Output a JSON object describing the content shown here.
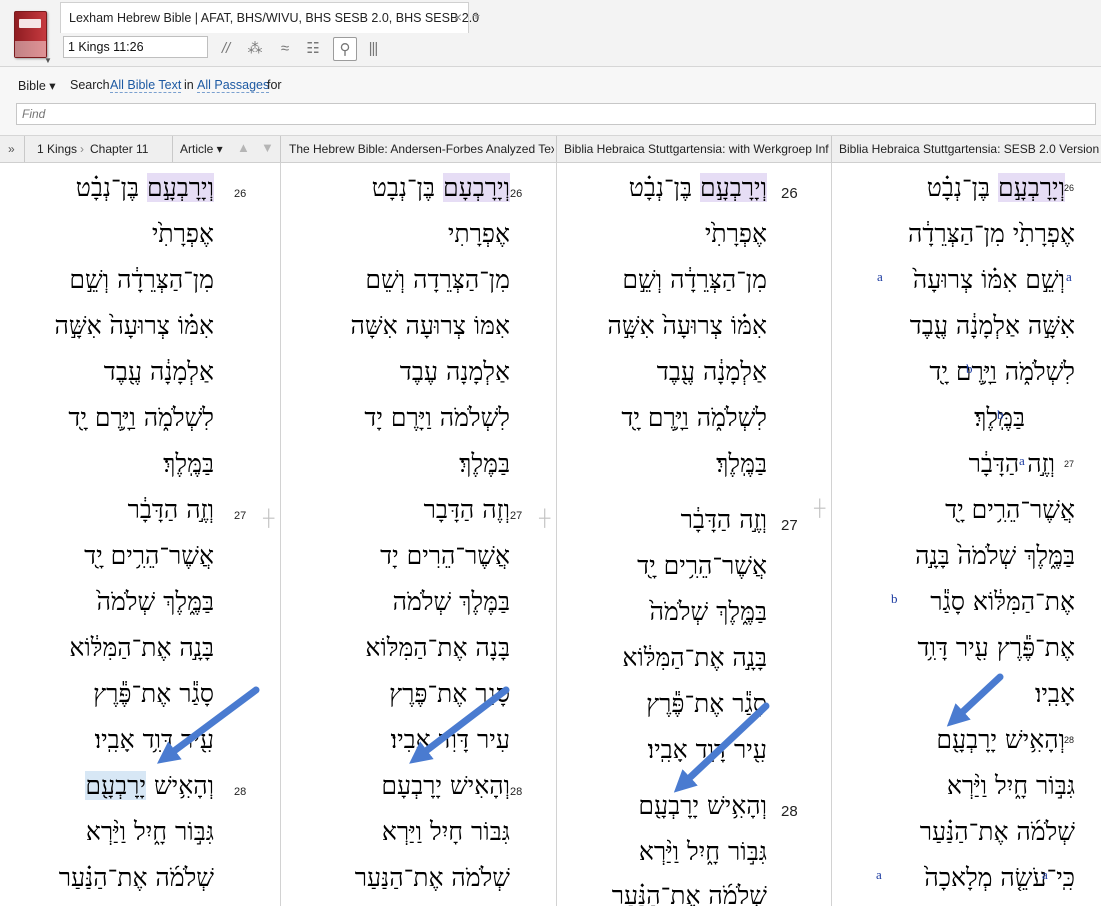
{
  "tab": {
    "title": "Lexham Hebrew Bible | AFAT, BHS/WIVU, BHS SESB 2.0, BHS SESB 2.0",
    "close": "×",
    "new_tab": "+"
  },
  "toolbar": {
    "reference": "1 Kings 11:26",
    "btn_parallel": "//",
    "btn_dots": "⁂",
    "btn_wave": "≈",
    "btn_list": "☷",
    "btn_search": "⚲",
    "btn_columns": "|||"
  },
  "search": {
    "bible_label": "Bible ▾",
    "search_label": "Search",
    "scope": "All Bible Text",
    "in": "in",
    "passages": "All Passages",
    "for": "for",
    "find_placeholder": "Find"
  },
  "header": {
    "collapse": "»",
    "breadcrumb_book": "1 Kings",
    "breadcrumb_sep": "›",
    "breadcrumb_chapter": "Chapter 11",
    "article": "Article ▾",
    "up": "▲",
    "down": "▼",
    "col2": "The Hebrew Bible: Andersen-Forbes Analyzed Text",
    "col3": "Biblia Hebraica Stuttgartensia: with Werkgroep Informatica",
    "col4": "Biblia Hebraica Stuttgartensia: SESB 2.0 Version"
  },
  "pane1": {
    "v26": "26",
    "v27": "27",
    "v28": "28",
    "l1_hl": "וְיָרָבְעָ֣ם",
    "l1_rest": " בֶּן־נְבָ֗ט",
    "l2": "אֶפְרָתִ֙י",
    "l3": "מִן־הַצְּרֵדָ֔ה וְשֵׁ֣ם",
    "l4": "אִמּ֗וֹ צְרוּעָה֙ אִשָּׁ֣ה",
    "l5": "אַלְמָנָ֔ה עֶ֖בֶד",
    "l6": "לִשְׁלֹמֹ֑ה וַיָּ֥רֶם יָ֖ד",
    "l7": "בַּמֶּֽלֶךְ׃",
    "l8": "וְזֶ֣ה הַדָּבָ֔ר",
    "l9": "אֲשֶׁר־הֵרִ֥ים יָ֖ד",
    "l10": "בַּמֶּ֑לֶךְ שְׁלֹמֹה֙",
    "l11": "בָּנָ֣ה אֶת־הַמִּלּ֔וֹא",
    "l12": "סָגַ֕ר אֶת־פֶּ֕רֶץ",
    "l13": "עִ֖יר דָּוִ֥ד אָבִֽיו׃",
    "l14_pre": "וְהָאִ֥ישׁ ",
    "l14_hl": "יָרָבְעָ֖ם",
    "l15": "גִּבּ֣וֹר חָ֑יִל וַיַּ֨רְא",
    "l16": "שְׁלֹמֹ֜ה אֶת־הַנַּ֗עַר"
  },
  "pane2": {
    "v26": "26",
    "v27": "27",
    "v28": "28",
    "l1_hl": "וְיָרָבְעָם",
    "l1_rest": " בֶּן־נְבָט",
    "l2": "אֶפְרָתִי",
    "l3": "מִן־הַצְּרֵדָה וְשֵׁם",
    "l4": "אִמּוֹ צְרוּעָה אִשָּׁה",
    "l5": "אַלְמָנָה עֶבֶד",
    "l6": "לִשְׁלֹמֹה וַיָּרֶם יָד",
    "l7": "בַּמֶּלֶךְ׃",
    "l8": "וְזֶה הַדָּבָר",
    "l9": "אֲשֶׁר־הֵרִים יָד",
    "l10": "בַּמֶּלֶךְ שְׁלֹמֹה",
    "l11": "בָּנָה אֶת־הַמִּלּוֹא",
    "l12": "סָגַר אֶת־פֶּרֶץ",
    "l13": "עִיר דָּוִד אָבִיו׃",
    "l14": "וְהָאִישׁ יָרָבְעָם",
    "l15": "גִּבּוֹר חָיִל וַיַּרְא",
    "l16": "שְׁלֹמֹה אֶת־הַנַּעַר"
  },
  "pane3": {
    "v26": "26",
    "v27": "27",
    "v28": "28",
    "l1_hl": "וְיָרָבְעָ֣ם",
    "l1_rest": " בֶּן־נְבָ֗ט",
    "l2": "אֶפְרָתִ֙י",
    "l3": "מִן־הַצְּרֵדָ֔ה וְשֵׁ֣ם",
    "l4": "אִמּ֗וֹ צְרוּעָה֙ אִשָּׁ֣ה",
    "l5": "אַלְמָנָ֔ה עֶ֖בֶד",
    "l6": "לִשְׁלֹמֹ֑ה וַיָּ֥רֶם יָ֖ד",
    "l7": "בַּמֶּֽלֶךְ׃",
    "l8": "וְזֶ֣ה הַדָּבָ֔ר",
    "l9": "אֲשֶׁר־הֵרִ֥ים יָ֖ד",
    "l10": "בַּמֶּ֑לֶךְ שְׁלֹמֹה֙",
    "l11": "בָּנָ֣ה אֶת־הַמִּלּ֔וֹא",
    "l12": "סָגַ֕ר אֶת־פֶּ֕רֶץ",
    "l13": "עִ֖יר דָּוִ֥ד אָבִֽיו׃",
    "l14": "וְהָאִ֥ישׁ יָרָבְעָ֖ם",
    "l15": "גִּבּ֣וֹר חָ֑יִל וַיַּ֨רְא",
    "l16": "שְׁלֹמֹ֜ה אֶת־הַנַּ֗עַר"
  },
  "pane4": {
    "v26": "26",
    "v27": "27",
    "v28": "28",
    "note_a": "a",
    "note_b": "b",
    "l1_hl": "וְיָרָבְעָ֣ם",
    "l1_rest": " בֶּן־נְבָ֗ט",
    "l2": "אֶפְרָתִ֙י מִן־הַצְּרֵדָ֔ה",
    "l3": "וְשֵׁ֣ם אִמּ֗וֹ צְרוּעָה֙",
    "l4": "אִשָּׁ֣ה אַלְמָנָ֔ה עֶ֖בֶד",
    "l5": "לִשְׁלֹמֹ֑ה וַיָּ֥רֶם יָ֖ד",
    "l6": "בַּמֶּֽלֶךְ׃",
    "l7": "וְזֶ֣ה הַדָּבָ֔ר",
    "l8": "אֲשֶׁר־הֵרִ֥ים יָ֖ד",
    "l9": "בַּמֶּ֑לֶךְ שְׁלֹמֹה֙ בָּנָ֣ה",
    "l10": "אֶת־הַמִּלּ֔וֹא סָגַ֕ר",
    "l11": "אֶת־פֶּ֕רֶץ עִ֖יר דָּוִ֥ד",
    "l12": "אָבִֽיו׃",
    "l13": "וְהָאִ֥ישׁ יָרָבְעָ֖ם",
    "l14": "גִּבּ֣וֹר חָ֑יִל וַיַּ֨רְא",
    "l15": "שְׁלֹמֹ֜ה אֶת־הַנַּ֗עַר",
    "l16": "כִּֽי־עֹשֵׂ֤ה מְלָאכָה֙"
  },
  "colors": {
    "highlight_purple": "#e6ddf5",
    "highlight_blue": "#d7e7f5",
    "annotation_arrow": "#4a7bd0",
    "link": "#1d5aa3"
  }
}
